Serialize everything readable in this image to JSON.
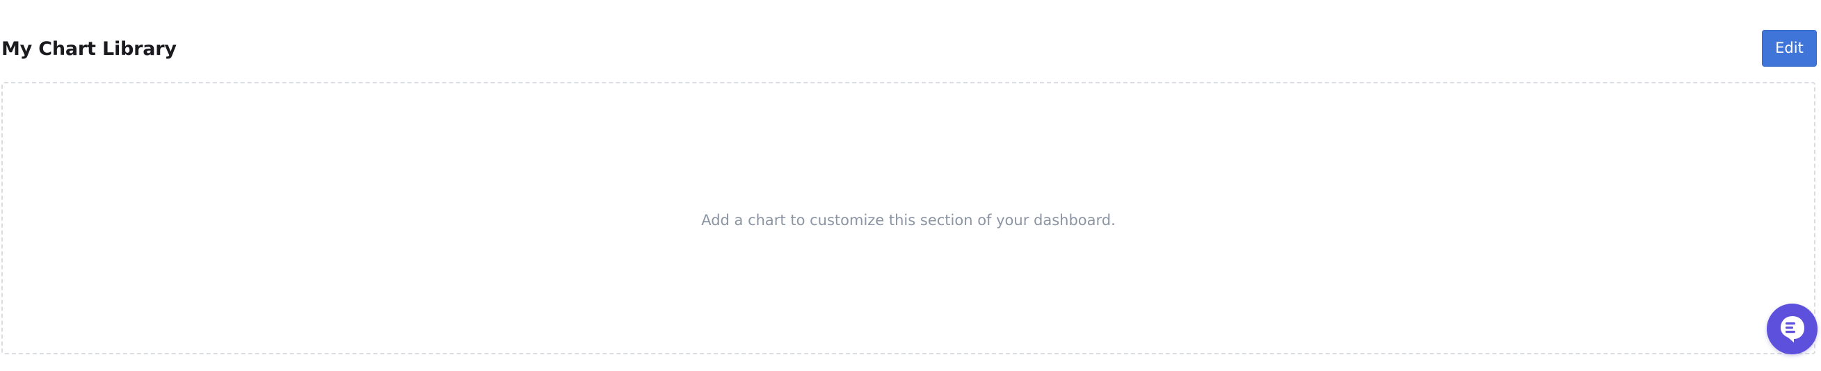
{
  "section": {
    "title": "My Chart Library",
    "edit_label": "Edit"
  },
  "dropzone": {
    "empty_message": "Add a chart to customize this section of your dashboard."
  },
  "chat_widget": {
    "icon": "chat-bubble-icon"
  },
  "colors": {
    "accent": "#3f75d8",
    "chat_widget": "#5d50dd",
    "muted_text": "#8b95a3",
    "dashed_border": "#d9dce1"
  }
}
